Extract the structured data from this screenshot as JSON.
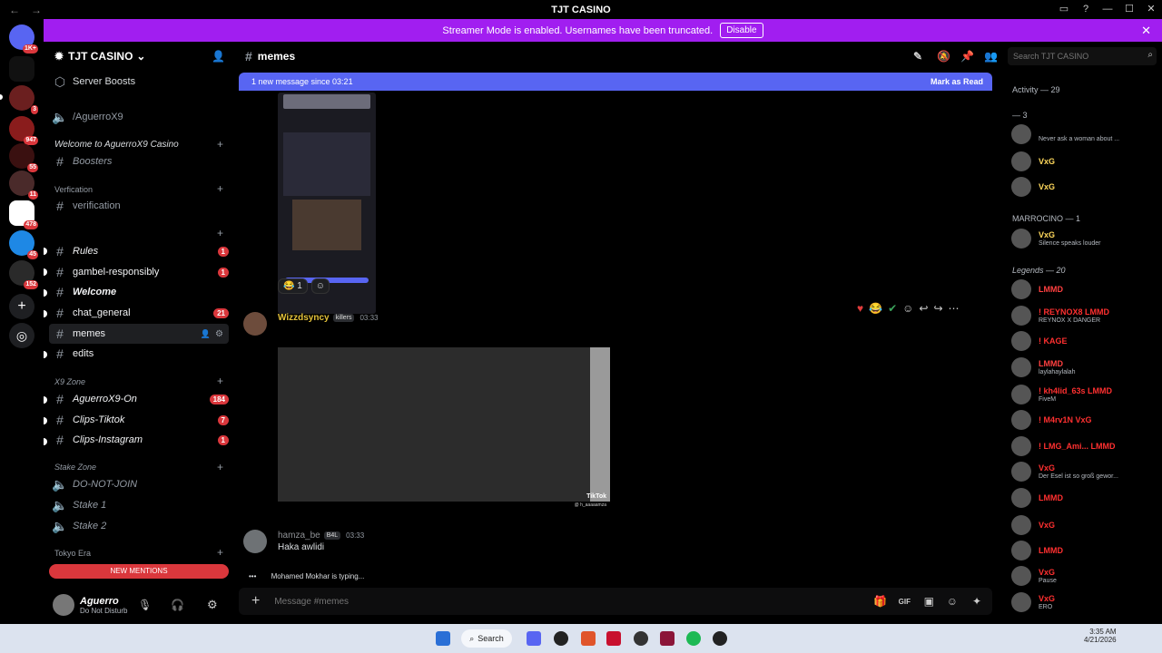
{
  "titlebar": {
    "title": "TJT CASINO",
    "back": "←",
    "forward": "→"
  },
  "banner": {
    "text": "Streamer Mode is enabled. Usernames have been truncated.",
    "disable": "Disable"
  },
  "rail": {
    "badges": [
      "1K+",
      "3",
      "947",
      "55",
      "11",
      "478",
      "45",
      "152"
    ]
  },
  "server": {
    "name": "TJT CASINO",
    "server_boosts": "Server Boosts",
    "channels": [
      {
        "label": "/AguerroX9",
        "type": "voice"
      },
      {
        "category": "Welcome to AguerroX9 Casino"
      },
      {
        "label": "Boosters",
        "type": "text"
      },
      {
        "category": "Verfication"
      },
      {
        "label": "verification",
        "type": "text"
      },
      {
        "label": "Rules",
        "type": "text",
        "count": "1"
      },
      {
        "label": "gambel-responsibly",
        "type": "text",
        "count": "1"
      },
      {
        "label": "Welcome",
        "type": "text"
      },
      {
        "label": "chat_general",
        "type": "text",
        "count": "21"
      },
      {
        "label": "memes",
        "type": "text"
      },
      {
        "label": "edits",
        "type": "text"
      },
      {
        "category": "X9 Zone"
      },
      {
        "label": "AguerroX9-On",
        "type": "text",
        "count": "184"
      },
      {
        "label": "Clips-Tiktok",
        "type": "text",
        "count": "7"
      },
      {
        "label": "Clips-Instagram",
        "type": "text",
        "count": "1"
      },
      {
        "category": "Stake Zone"
      },
      {
        "label": "DO-NOT-JOIN",
        "type": "voice"
      },
      {
        "label": "Stake 1",
        "type": "voice"
      },
      {
        "label": "Stake 2",
        "type": "voice"
      },
      {
        "category": "Tokyo Era"
      }
    ],
    "new_mentions": "NEW MENTIONS"
  },
  "user": {
    "name": "Aguerro",
    "status": "Do Not Disturb"
  },
  "channel": {
    "name": "memes",
    "new_message_bar": "1 new message since 03:21",
    "mark_as_read": "Mark as Read",
    "reaction_count": "1",
    "messages": [
      {
        "author": "Wizzdsyncy",
        "tag": "killers",
        "time": "03:33",
        "color": "#e5c33a"
      },
      {
        "author": "hamza_be",
        "tag": "B4L",
        "time": "03:33",
        "text": "Haka awlidi",
        "color": "#8f9296"
      }
    ],
    "video_watermark": "TikTok",
    "video_handle": "@ h_aaaaamza",
    "typing": "Mohamed Mokhar is typing...",
    "composer_placeholder": "Message #memes"
  },
  "members": {
    "search_placeholder": "Search TJT CASINO",
    "activity": "Activity — 29",
    "group1": "— 3",
    "group2": "MARROCINO — 1",
    "group3": "Legends — 20",
    "rows": [
      {
        "name": "",
        "status": "Never ask a woman about ...",
        "color": "#ff5c5c"
      },
      {
        "name": "VxG",
        "status": "",
        "color": "#ffd95c"
      },
      {
        "name": "VxG",
        "status": "",
        "color": "#ffd95c"
      },
      {
        "name": "VxG",
        "status": "Silence speaks louder",
        "color": "#ffd95c"
      },
      {
        "name": "LMMD",
        "status": "",
        "color": "#ff4040"
      },
      {
        "name": "! REYNOX8 LMMD",
        "status": "REYNOX X DANGER",
        "color": "#ff3030"
      },
      {
        "name": "! KAGE",
        "status": "",
        "color": "#ff3030"
      },
      {
        "name": "LMMD",
        "status": "laylahaylalah",
        "color": "#ff4040"
      },
      {
        "name": "! kh4lid_63s LMMD",
        "status": "FiveM",
        "color": "#ff3030"
      },
      {
        "name": "! M4rv1N VxG",
        "status": "",
        "color": "#ff3030"
      },
      {
        "name": "! LMG_Ami... LMMD",
        "status": "",
        "color": "#ff3030"
      },
      {
        "name": "VxG",
        "status": "Der Esel ist so groß gewor...",
        "color": "#ff3030"
      },
      {
        "name": "LMMD",
        "status": "",
        "color": "#ff3030"
      },
      {
        "name": "VxG",
        "status": "",
        "color": "#ff3030"
      },
      {
        "name": "LMMD",
        "status": "",
        "color": "#ff3030"
      },
      {
        "name": "VxG",
        "status": "Pause",
        "color": "#ff3030"
      },
      {
        "name": "VxG",
        "status": "ERO",
        "color": "#ff3030"
      }
    ]
  },
  "taskbar": {
    "search": "Search",
    "time": "3:35 AM",
    "date": "4/21/2026"
  },
  "colors": {
    "banner": "#a11ef0",
    "blurple": "#5865f2",
    "red": "#da373c"
  }
}
